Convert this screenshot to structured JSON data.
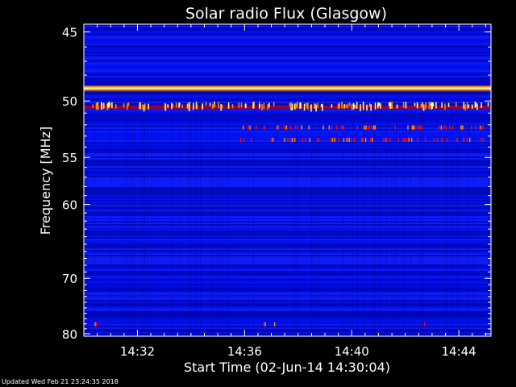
{
  "chart_data": {
    "type": "heatmap",
    "title": "Solar radio Flux (Glasgow)",
    "xlabel": "Start Time (02-Jun-14 14:30:04)",
    "ylabel": "Frequency [MHz]",
    "xlim_minutes": [
      0,
      15.2
    ],
    "ylim_mhz": [
      44.5,
      80.5
    ],
    "x_ticks": [
      {
        "label": "14:32",
        "minute": 2
      },
      {
        "label": "14:36",
        "minute": 6
      },
      {
        "label": "14:40",
        "minute": 10
      },
      {
        "label": "14:44",
        "minute": 14
      }
    ],
    "y_ticks": [
      45,
      50,
      55,
      60,
      70,
      80
    ],
    "y_scale": "reciprocal",
    "grid": false,
    "colormap": [
      "#00003a",
      "#0000c8",
      "#0018ff",
      "#ff0000",
      "#ff8800",
      "#ffff80"
    ],
    "features": [
      {
        "name": "continuous emission band",
        "freq_mhz": 49.0,
        "intensity": "high"
      },
      {
        "name": "bursty band",
        "freq_mhz": 50.5,
        "intensity": "medium-high"
      },
      {
        "name": "sparse spikes",
        "freq_mhz": 52.2,
        "intensity": "medium"
      },
      {
        "name": "sparse spikes",
        "freq_mhz": 53.3,
        "intensity": "medium"
      },
      {
        "name": "isolated spikes",
        "freq_mhz": 78.0,
        "intensity": "medium"
      }
    ]
  },
  "footer": {
    "updated": "Updated Wed Feb 21 23:24:35 2018"
  }
}
